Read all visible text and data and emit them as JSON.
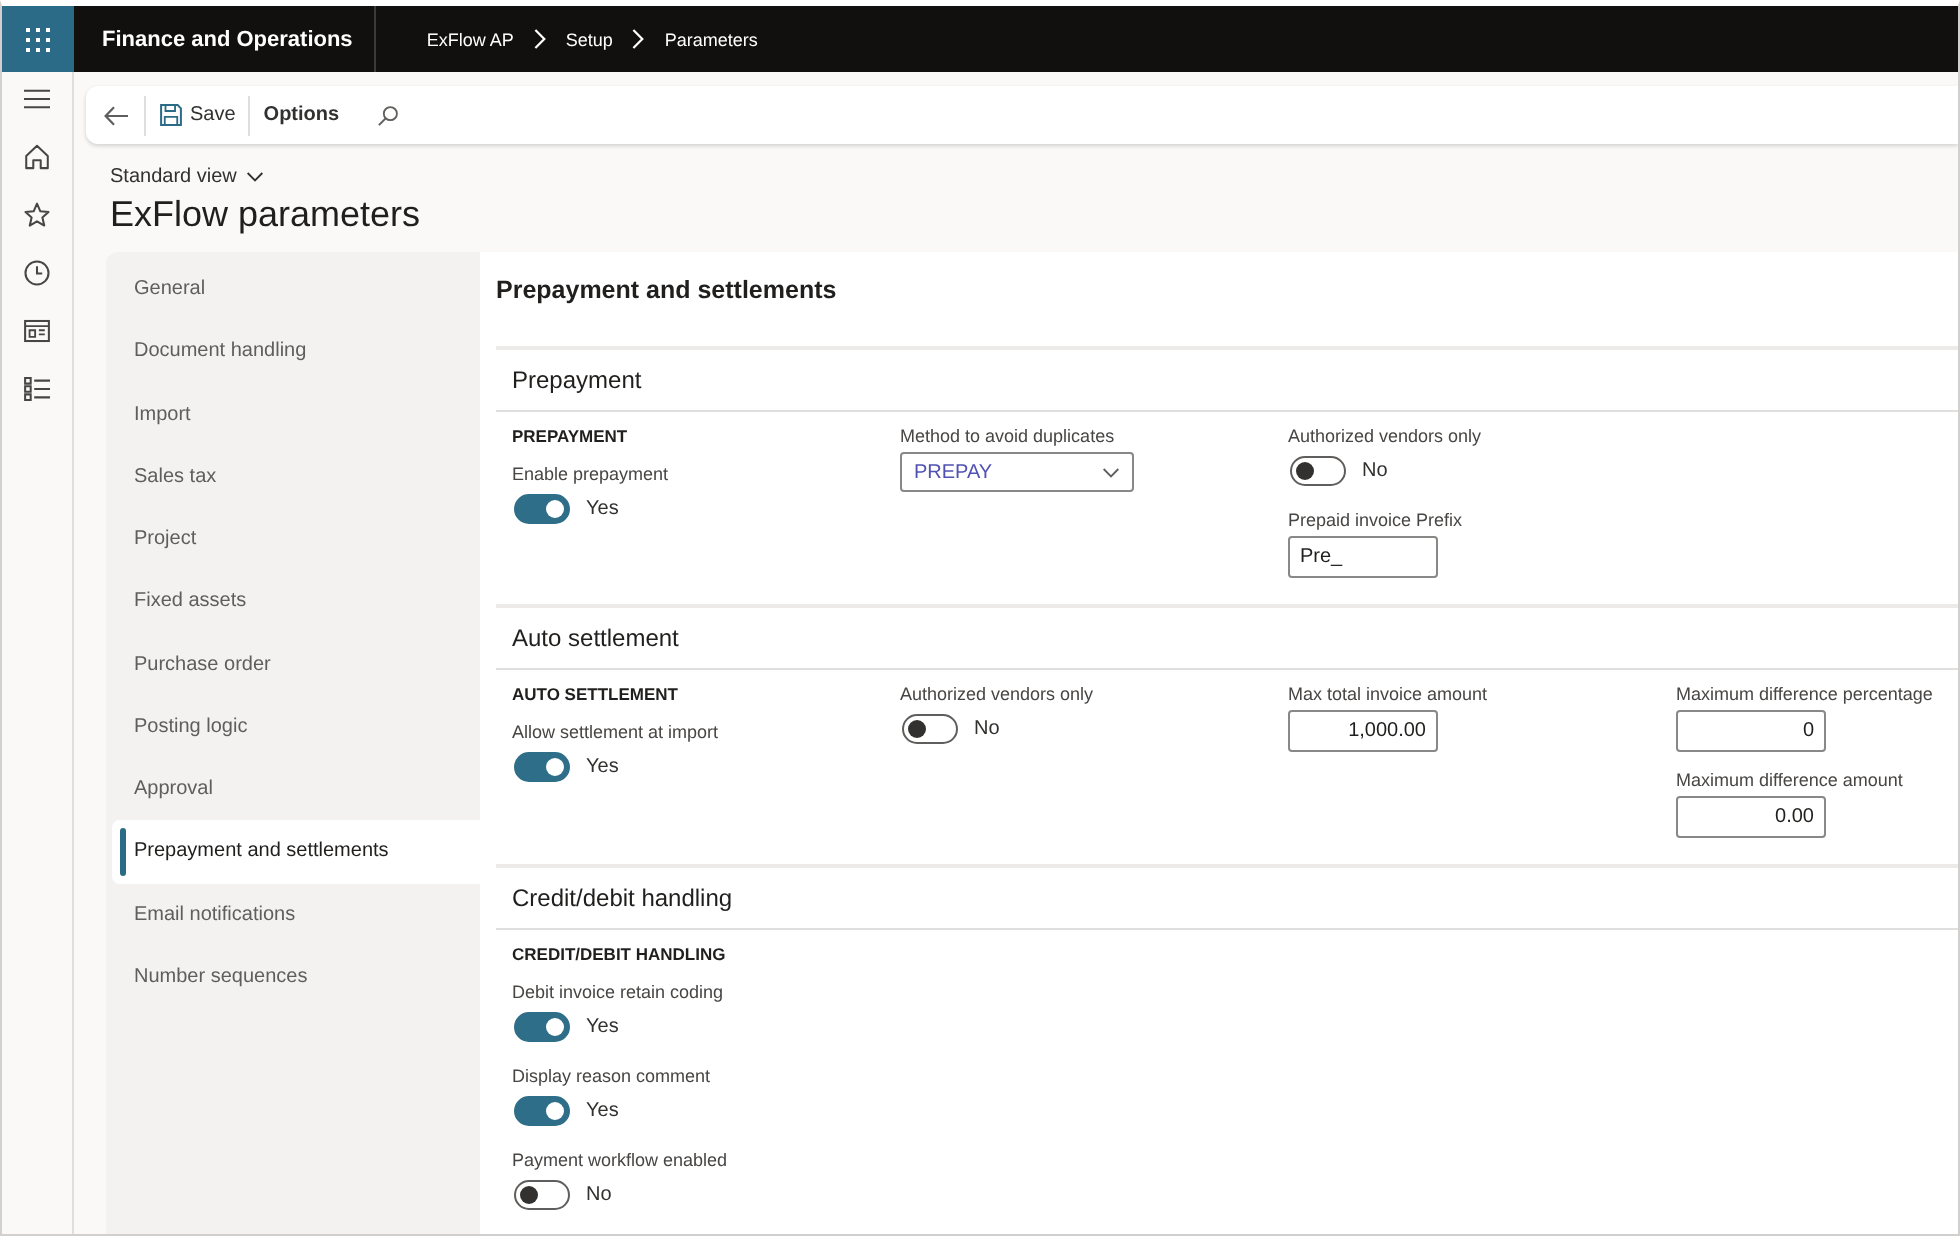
{
  "app": {
    "title": "Finance and Operations"
  },
  "breadcrumb": [
    {
      "label": "ExFlow AP"
    },
    {
      "label": "Setup"
    },
    {
      "label": "Parameters"
    }
  ],
  "toolbar": {
    "save": "Save",
    "options": "Options"
  },
  "page": {
    "view": "Standard view",
    "title": "ExFlow parameters"
  },
  "tabs": [
    {
      "label": "General",
      "selected": false
    },
    {
      "label": "Document handling",
      "selected": false
    },
    {
      "label": "Import",
      "selected": false
    },
    {
      "label": "Sales tax",
      "selected": false
    },
    {
      "label": "Project",
      "selected": false
    },
    {
      "label": "Fixed assets",
      "selected": false
    },
    {
      "label": "Purchase order",
      "selected": false
    },
    {
      "label": "Posting logic",
      "selected": false
    },
    {
      "label": "Approval",
      "selected": false
    },
    {
      "label": "Prepayment and settlements",
      "selected": true
    },
    {
      "label": "Email notifications",
      "selected": false
    },
    {
      "label": "Number sequences",
      "selected": false
    }
  ],
  "pane": {
    "title": "Prepayment and settlements",
    "sections": [
      {
        "title": "Prepayment",
        "columns": [
          [
            {
              "kind": "group",
              "label": "PREPAYMENT"
            },
            {
              "kind": "toggle",
              "label": "Enable prepayment",
              "on": true,
              "value": "Yes"
            }
          ],
          [
            {
              "kind": "dropdown",
              "label": "Method to avoid duplicates",
              "value": "PREPAY"
            }
          ],
          [
            {
              "kind": "toggle",
              "label": "Authorized vendors only",
              "on": false,
              "value": "No"
            },
            {
              "kind": "text",
              "label": "Prepaid invoice Prefix",
              "value": "Pre_"
            }
          ]
        ]
      },
      {
        "title": "Auto settlement",
        "columns": [
          [
            {
              "kind": "group",
              "label": "AUTO SETTLEMENT"
            },
            {
              "kind": "toggle",
              "label": "Allow settlement at import",
              "on": true,
              "value": "Yes"
            }
          ],
          [
            {
              "kind": "toggle",
              "label": "Authorized vendors only",
              "on": false,
              "value": "No"
            }
          ],
          [
            {
              "kind": "number",
              "label": "Max total invoice amount",
              "value": "1,000.00"
            }
          ],
          [
            {
              "kind": "number",
              "label": "Maximum difference percentage",
              "value": "0"
            },
            {
              "kind": "number",
              "label": "Maximum difference amount",
              "value": "0.00"
            }
          ]
        ]
      },
      {
        "title": "Credit/debit handling",
        "columns": [
          [
            {
              "kind": "group",
              "label": "CREDIT/DEBIT HANDLING"
            },
            {
              "kind": "toggle",
              "label": "Debit invoice retain coding",
              "on": true,
              "value": "Yes"
            },
            {
              "kind": "toggle",
              "label": "Display reason comment",
              "on": true,
              "value": "Yes"
            },
            {
              "kind": "toggle",
              "label": "Payment workflow enabled",
              "on": false,
              "value": "No"
            }
          ]
        ]
      }
    ]
  }
}
